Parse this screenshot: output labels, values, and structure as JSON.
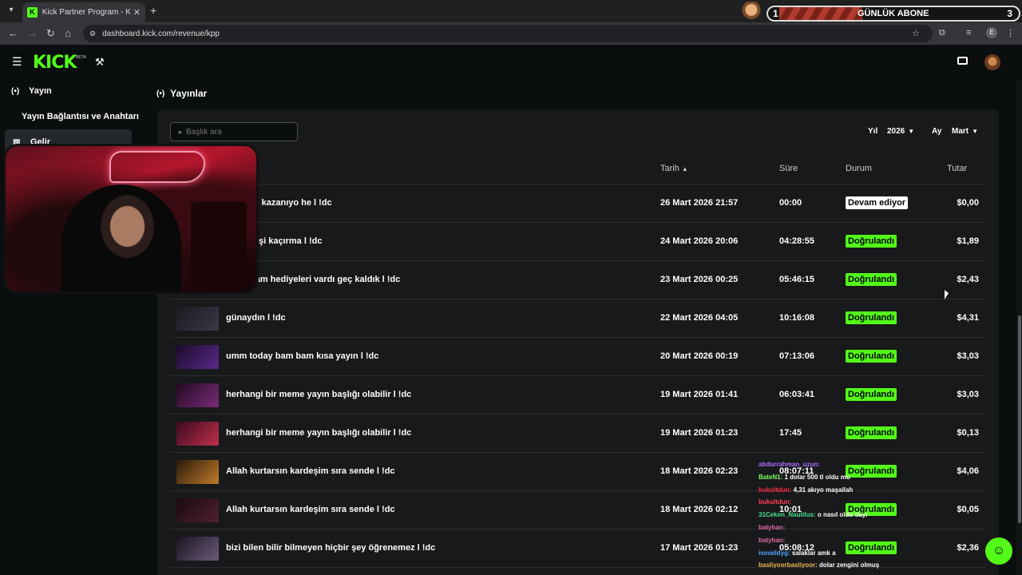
{
  "browser": {
    "tab_title": "Kick Partner Program - Kick Das",
    "url": "dashboard.kick.com/revenue/kpp",
    "profile_initial": "E"
  },
  "overlay": {
    "sub_count_left": "1",
    "sub_label": "GÜNLÜK ABONE",
    "sub_count_right": "3"
  },
  "header": {
    "logo": "KICK",
    "beta": "BETA"
  },
  "sidebar": {
    "items": [
      {
        "label": "Yayın"
      },
      {
        "label": "Yayın Bağlantısı ve Anahtarı"
      },
      {
        "label": "Gelir"
      }
    ]
  },
  "main": {
    "section_title": "Yayınlar",
    "search_placeholder": "Başlık ara",
    "year_label": "Yıl",
    "year_value": "2026",
    "month_label": "Ay",
    "month_value": "Mart",
    "columns": {
      "date": "Tarih",
      "duration": "Süre",
      "status": "Durum",
      "amount": "Tutar"
    },
    "rows": [
      {
        "title": "ar da iyi kazanıyo he l !dc",
        "date": "26 Mart 2026 21:57",
        "duration": "00:00",
        "status": "Devam ediyor",
        "amount": "$0,00"
      },
      {
        "title": "er çekilişi kaçırma l !dc",
        "date": "24 Mart 2026 20:06",
        "duration": "04:28:55",
        "status": "Doğrulandı",
        "amount": "$1,89"
      },
      {
        "title": "er bayram hediyeleri vardı geç kaldık l !dc",
        "date": "23 Mart 2026 00:25",
        "duration": "05:46:15",
        "status": "Doğrulandı",
        "amount": "$2,43"
      },
      {
        "title": "günaydın l !dc",
        "date": "22 Mart 2026 04:05",
        "duration": "10:16:08",
        "status": "Doğrulandı",
        "amount": "$4,31"
      },
      {
        "title": "umm today bam bam kısa yayın l !dc",
        "date": "20 Mart 2026 00:19",
        "duration": "07:13:06",
        "status": "Doğrulandı",
        "amount": "$3,03"
      },
      {
        "title": "herhangi bir meme yayın başlığı olabilir l !dc",
        "date": "19 Mart 2026 01:41",
        "duration": "06:03:41",
        "status": "Doğrulandı",
        "amount": "$3,03"
      },
      {
        "title": "herhangi bir meme yayın başlığı olabilir l !dc",
        "date": "19 Mart 2026 01:23",
        "duration": "17:45",
        "status": "Doğrulandı",
        "amount": "$0,13"
      },
      {
        "title": "Allah kurtarsın kardeşim sıra sende l !dc",
        "date": "18 Mart 2026 02:23",
        "duration": "08:07:11",
        "status": "Doğrulandı",
        "amount": "$4,06"
      },
      {
        "title": "Allah kurtarsın kardeşim sıra sende l !dc",
        "date": "18 Mart 2026 02:12",
        "duration": "10:01",
        "status": "Doğrulandı",
        "amount": "$0,05"
      },
      {
        "title": "bizi bilen bilir bilmeyen hiçbir şey öğrenemez l !dc",
        "date": "17 Mart 2026 01:23",
        "duration": "05:08:12",
        "status": "Doğrulandı",
        "amount": "$2,36"
      }
    ]
  },
  "chat": [
    {
      "user": "abdurrahman_uzun:",
      "msg": ""
    },
    {
      "user": "BateN1:",
      "msg": "1 dolar 500 tl oldu mu"
    },
    {
      "user": "bukultdun:",
      "msg": "4,31 akıyo maşallah"
    },
    {
      "user": "bukultdun:",
      "msg": ""
    },
    {
      "user": "31Ceken_Nautilus:",
      "msg": "o nasıl oldu dayı"
    },
    {
      "user": "batyhan:",
      "msg": ""
    },
    {
      "user": "batyhan:",
      "msg": ""
    },
    {
      "user": "ismaildyg:",
      "msg": "salaklar amk a"
    },
    {
      "user": "basliyoorbasliyoor:",
      "msg": "dolar zengini olmuş"
    }
  ],
  "colors": {
    "accent": "#53fc18",
    "panel": "#18191b",
    "bg": "#0b0e0f"
  }
}
